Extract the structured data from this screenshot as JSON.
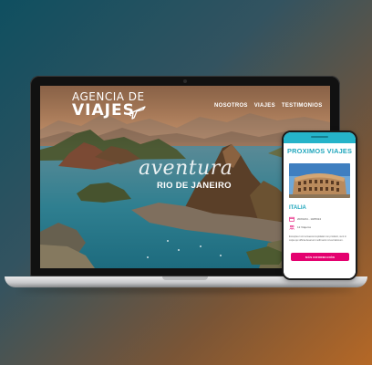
{
  "site": {
    "brand_line1": "AGENCIA DE",
    "brand_line2": "VIAJES",
    "nav": [
      "NOSOTROS",
      "VIAJES",
      "TESTIMONIOS"
    ]
  },
  "hero": {
    "script": "aventura",
    "title": "RIO DE JANEIRO"
  },
  "phone": {
    "title": "PROXIMOS VIAJES",
    "destination": "ITALIA",
    "dates": "20/04/24 - 10/05/24",
    "travelers": "12 Viajeros",
    "description": "Excepteur sint occaecat cupidatat non proident, sunt in culpa qui officia deserunt mollit anim id est laborum.",
    "button_label": "MÁS INFORMACIÓN"
  },
  "colors": {
    "accent": "#22a7bd",
    "button": "#e4006f"
  },
  "icons": [
    "plane-icon",
    "calendar-icon",
    "people-icon"
  ]
}
